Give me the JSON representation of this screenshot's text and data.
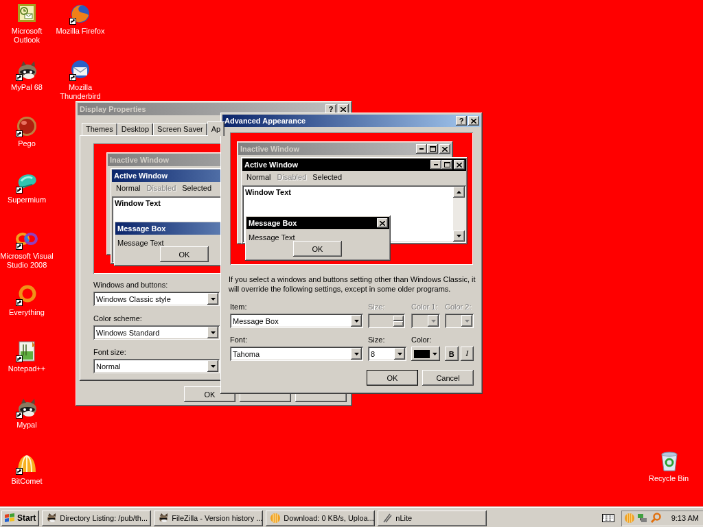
{
  "desktop": {
    "icons": [
      {
        "label": "Microsoft Outlook",
        "kind": "outlook",
        "shortcut": false
      },
      {
        "label": "MyPal 68",
        "kind": "raccoon",
        "shortcut": true
      },
      {
        "label": "Pego",
        "kind": "pego",
        "shortcut": true
      },
      {
        "label": "Supermium",
        "kind": "blob",
        "shortcut": true
      },
      {
        "label": "Microsoft Visual Studio 2008",
        "kind": "infinity",
        "shortcut": true
      },
      {
        "label": "Everything",
        "kind": "ring",
        "shortcut": true
      },
      {
        "label": "Notepad++",
        "kind": "notepad",
        "shortcut": true
      },
      {
        "label": "Mypal",
        "kind": "raccoon",
        "shortcut": true
      },
      {
        "label": "BitComet",
        "kind": "dome",
        "shortcut": true
      },
      {
        "label": "Mozilla Firefox",
        "kind": "globe",
        "shortcut": true
      },
      {
        "label": "Mozilla Thunderbird",
        "kind": "envelope",
        "shortcut": true
      }
    ],
    "recycle_bin": {
      "label": "Recycle Bin"
    }
  },
  "display_properties": {
    "title": "Display Properties",
    "active": false,
    "help_button": "?",
    "tabs": [
      {
        "label": "Themes",
        "selected": false
      },
      {
        "label": "Desktop",
        "selected": false
      },
      {
        "label": "Screen Saver",
        "selected": false
      },
      {
        "label": "Ap",
        "selected": true
      }
    ],
    "preview": {
      "kind": "classic",
      "inactive_title": "Inactive Window",
      "active_title": "Active Window",
      "menu": [
        {
          "label": "Normal",
          "disabled": false
        },
        {
          "label": "Disabled",
          "disabled": true
        },
        {
          "label": "Selected",
          "disabled": false
        }
      ],
      "window_text": "Window Text",
      "message_title": "Message Box",
      "message_text": "Message Text",
      "button": "OK"
    },
    "fields": [
      {
        "label": "Windows and buttons:",
        "value": "Windows Classic style"
      },
      {
        "label": "Color scheme:",
        "value": "Windows Standard"
      },
      {
        "label": "Font size:",
        "value": "Normal"
      }
    ],
    "buttons": [
      {
        "label": "OK"
      }
    ]
  },
  "advanced_appearance": {
    "title": "Advanced Appearance",
    "active": true,
    "help_button": "?",
    "preview": {
      "kind": "custom",
      "inactive_title": "Inactive Window",
      "active_title": "Active Window",
      "menu": [
        {
          "label": "Normal",
          "disabled": false
        },
        {
          "label": "Disabled",
          "disabled": true
        },
        {
          "label": "Selected",
          "disabled": false
        }
      ],
      "window_text": "Window Text",
      "message_title": "Message Box",
      "message_text": "Message Text",
      "button": "OK"
    },
    "note": "If you select a windows and buttons setting other than Windows Classic, it will override the following settings, except in some older programs.",
    "item": {
      "label": "Item:",
      "value": "Message Box"
    },
    "item_size": {
      "label": "Size:",
      "disabled": true
    },
    "color_1": {
      "label": "Color 1:",
      "disabled": true
    },
    "color_2": {
      "label": "Color 2:",
      "disabled": true
    },
    "font": {
      "label": "Font:",
      "value": "Tahoma"
    },
    "font_size": {
      "label": "Size:",
      "value": "8"
    },
    "font_color": {
      "label": "Color:"
    },
    "bold_button": "B",
    "italic_button": "I",
    "buttons": [
      {
        "label": "OK",
        "default": true
      },
      {
        "label": "Cancel",
        "default": false
      }
    ]
  },
  "taskbar": {
    "start": "Start",
    "tasks": [
      {
        "label": "Directory Listing: /pub/th...",
        "kind": "animal"
      },
      {
        "label": "FileZilla - Version history ...",
        "kind": "animal"
      },
      {
        "label": "Download: 0 KB/s, Uploa...",
        "kind": "ball"
      },
      {
        "label": "nLite",
        "kind": "pen"
      }
    ],
    "tray": [
      {
        "kind": "ball"
      },
      {
        "kind": "network"
      },
      {
        "kind": "magnifier"
      }
    ],
    "clock": "9:13 AM"
  }
}
